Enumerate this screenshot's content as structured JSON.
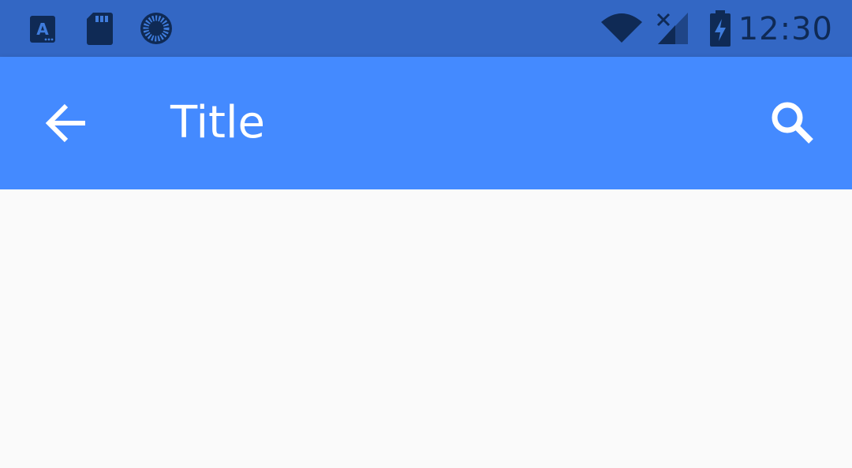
{
  "status_bar": {
    "left_icons": [
      "app-a-icon",
      "sd-card-icon",
      "sync-circle-icon"
    ],
    "right_icons": [
      "wifi-icon",
      "signal-no-data-icon",
      "battery-charging-icon"
    ],
    "time": "12:30"
  },
  "app_bar": {
    "title": "Title",
    "back_icon": "arrow-back-icon",
    "search_icon": "search-icon"
  },
  "colors": {
    "status_bar": "#3367c4",
    "app_bar": "#448aff",
    "background": "#fafafa",
    "status_icons": "#0f2a55"
  }
}
